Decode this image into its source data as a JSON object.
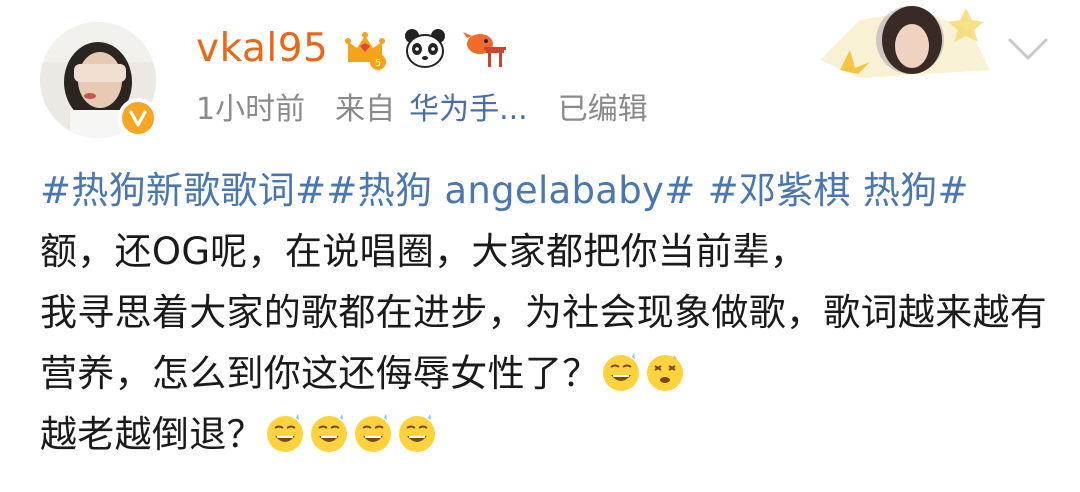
{
  "post": {
    "username": "vkal95",
    "time": "1小时前",
    "source_prefix": "来自",
    "source": "华为手...",
    "edited": "已编辑",
    "icons": [
      "verified-icon",
      "crown-level-icon",
      "panda-icon",
      "goldfish-icon",
      "chevron-down-icon"
    ],
    "text": {
      "topic1": "#热狗新歌歌词#",
      "topic2": "#热狗 angelababy#",
      "topic3": "#邓紫棋 热狗#",
      "line1": " 额，还OG呢，在说唱圈，大家都把你当前辈，",
      "line2": "我寻思着大家的歌都在进步，为社会现象做歌，歌词越来越有营养，怎么到你这还侮辱女性了？",
      "line3": "越老越倒退？"
    },
    "colors": {
      "username": "#e8681a",
      "topic": "#4a77b0",
      "meta": "#8a8a8a",
      "verified": "#f5a623"
    }
  }
}
